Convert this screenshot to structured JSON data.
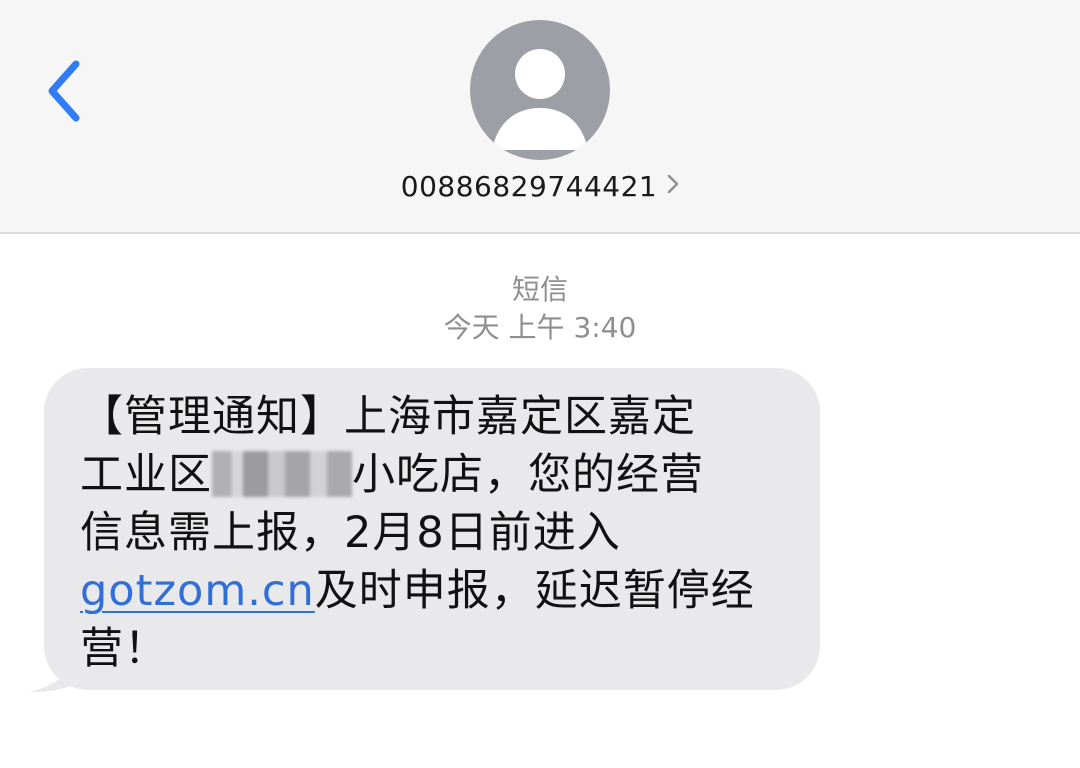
{
  "header": {
    "contact_number": "00886829744421"
  },
  "conversation": {
    "service_label": "短信",
    "timestamp": "今天 上午 3:40"
  },
  "message": {
    "line1": "【管理通知】上海市嘉定区嘉定",
    "line2_before": "工业区",
    "line2_after": "小吃店，您的经营",
    "line3": "信息需上报，2月8日前进入",
    "link_text": "gotzom.cn",
    "line4_after": "及时申报，延迟暂停经",
    "line5": "营！"
  },
  "colors": {
    "accent": "#2f7cf6",
    "bubble": "#e9e9eb",
    "header_bg": "#f6f6f6",
    "avatar": "#9d9fa6",
    "meta_text": "#8e8e93",
    "link": "#2f6fd6"
  },
  "icons": {
    "back": "chevron-left-icon",
    "avatar": "person-silhouette-icon",
    "contact_detail": "chevron-right-icon"
  }
}
